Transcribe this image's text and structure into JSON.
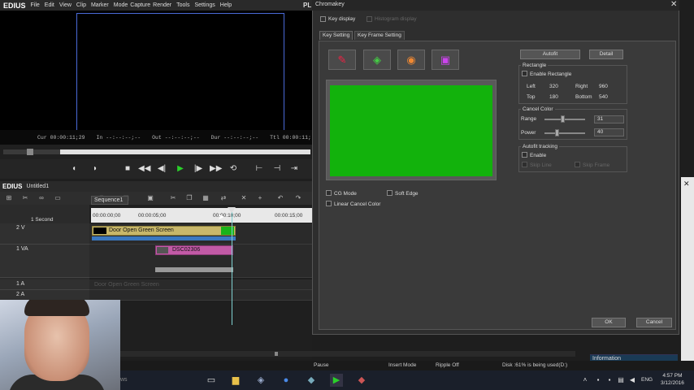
{
  "menubar": {
    "logo": "EDIUS",
    "items": [
      "File",
      "Edit",
      "View",
      "Clip",
      "Marker",
      "Mode",
      "Capture",
      "Render",
      "Tools",
      "Settings",
      "Help"
    ],
    "pl": "PL"
  },
  "timecode": {
    "cur": "Cur 00:00:11;29",
    "in": "In --:--:--;--",
    "out": "Out --:--:--;--",
    "dur": "Dur --:--:--;--",
    "ttl": "Ttl 00:00:11;"
  },
  "timeline": {
    "logo": "EDIUS",
    "project": "Untitled1",
    "sequence_tab": "Sequence1",
    "scale": "1 Second",
    "ruler_ticks": [
      "00:00:00;00",
      "00:00:05;00",
      "00:00:10;00",
      "00:00:15;00"
    ],
    "tracks": [
      {
        "name": "2 V"
      },
      {
        "name": "1 VA"
      },
      {
        "name": "1 A"
      },
      {
        "name": "2 A"
      }
    ],
    "clips": {
      "green": "Door Open Green Screen",
      "pink": "DSC02306",
      "faded": "Door Open Green Screen"
    }
  },
  "status": {
    "pause": "Pause",
    "insert": "Insert Mode",
    "ripple": "Ripple Off",
    "disk": "Disk :61% is being used(D:)"
  },
  "info_panel": "Information",
  "taskbar": {
    "time": "4:57 PM",
    "date": "3/12/2016",
    "lang": "ENG",
    "partial_text": "ws"
  },
  "chromakey": {
    "title": "Chromakey",
    "key_display": "Key display",
    "histogram_display": "Histogram display",
    "tabs": [
      "Key Setting",
      "Key Frame Setting"
    ],
    "autofit": "Autofit",
    "detail": "Detail",
    "rectangle": {
      "title": "Rectangle",
      "enable": "Enable Rectangle",
      "left_label": "Left",
      "left": "320",
      "right_label": "Right",
      "right": "960",
      "top_label": "Top",
      "top": "180",
      "bottom_label": "Bottom",
      "bottom": "540"
    },
    "cancel_color": {
      "title": "Cancel Color",
      "range_label": "Range",
      "range": "31",
      "power_label": "Power",
      "power": "40"
    },
    "autofit_tracking": {
      "title": "Autofit tracking",
      "enable": "Enable",
      "skip_line": "Skip Line",
      "skip_frame": "Skip Frame"
    },
    "cg_mode": "CG Mode",
    "soft_edge": "Soft Edge",
    "linear_cancel": "Linear Cancel Color",
    "ok": "OK",
    "cancel": "Cancel",
    "key_color": "#12b20c"
  }
}
